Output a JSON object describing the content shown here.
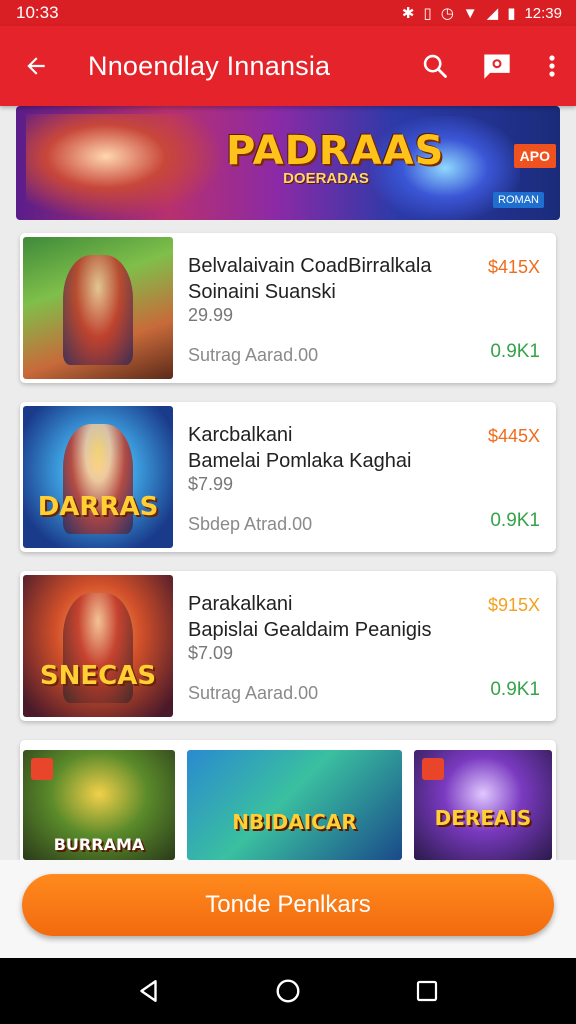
{
  "status_bar": {
    "time_left": "10:33",
    "time_right": "12:39",
    "icons": [
      "bluetooth-icon",
      "vibrate-icon",
      "alarm-icon",
      "wifi-icon",
      "signal-icon",
      "battery-icon"
    ]
  },
  "app_bar": {
    "title": "Nnoendlay Innansia",
    "icons": {
      "back": "back-arrow-icon",
      "search": "search-icon",
      "message": "message-icon",
      "more": "more-vert-icon"
    }
  },
  "banner": {
    "title": "PADRAAS",
    "subtitle": "DOERADAS",
    "badge": "APO",
    "tag": "ROMAN"
  },
  "items": [
    {
      "line1": "Belvalaivain CoadBirralkala",
      "line2": "Soinaini Suanski",
      "price": "29.99",
      "meta": "Sutrag Aarad.00",
      "badge": "$415X",
      "count": "0.9K1",
      "caption": ""
    },
    {
      "line1": "Karcbalkani",
      "line2": "Bamelai Pomlaka Kaghai",
      "price": "$7.99",
      "meta": "Sbdep Atrad.00",
      "badge": "$445X",
      "count": "0.9K1",
      "caption": "DARRAS"
    },
    {
      "line1": "Parakalkani",
      "line2": "Bapislai Gealdaim    Peanigis",
      "price": "$7.09",
      "meta": "Sutrag Aarad.00",
      "badge": "$915X",
      "count": "0.9K1",
      "caption": "SNECAS"
    }
  ],
  "tiles": [
    {
      "caption": "BURRAMA"
    },
    {
      "caption": "NBIDAICAR"
    },
    {
      "caption": "DEREAIS"
    }
  ],
  "cta": {
    "label": "Tonde Penlkars"
  },
  "colors": {
    "primary": "#e4242a",
    "accent": "#f26a0e",
    "price_badge": "#ef6c1e",
    "count": "#36a34a"
  }
}
